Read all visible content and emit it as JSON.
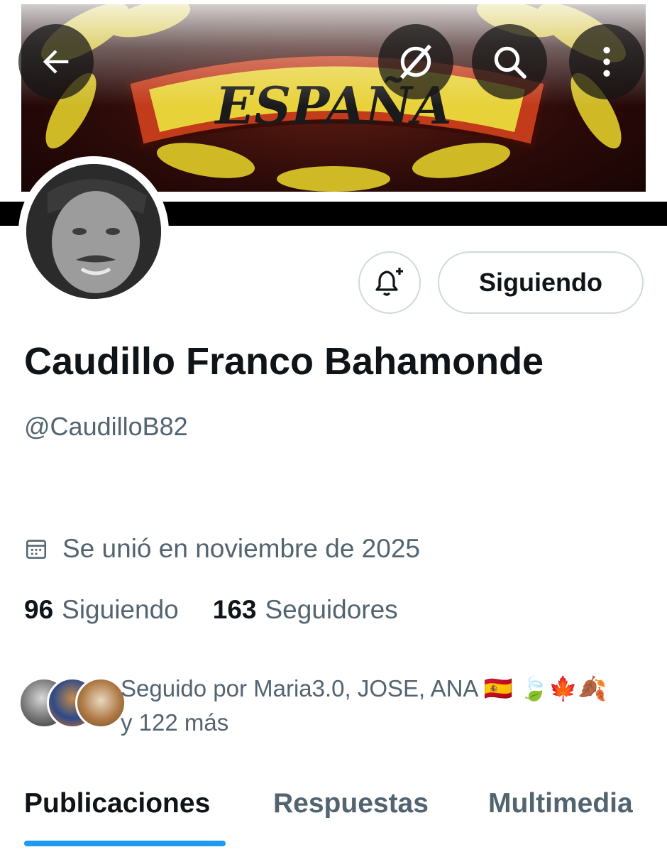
{
  "banner": {
    "text": "ESPAÑA"
  },
  "header": {
    "back_icon": "arrow-left-icon",
    "grok_icon": "grok-icon",
    "search_icon": "search-icon",
    "more_icon": "more-vertical-icon"
  },
  "profile": {
    "display_name": "Caudillo Franco Bahamonde",
    "handle": "@CaudilloB82",
    "joined": "Se unió en noviembre de 2025",
    "following_count": "96",
    "following_label": "Siguiendo",
    "followers_count": "163",
    "followers_label": "Seguidores",
    "followed_by_line1": "Seguido por Maria3.0, JOSE, ANA 🇪🇸 🍃🍁🍂",
    "followed_by_line2": "y 122 más"
  },
  "actions": {
    "notify_icon": "bell-plus-icon",
    "follow_label": "Siguiendo"
  },
  "tabs": [
    {
      "label": "Publicaciones",
      "active": true
    },
    {
      "label": "Respuestas",
      "active": false
    },
    {
      "label": "Multimedia",
      "active": false
    }
  ],
  "colors": {
    "accent": "#1d9bf0",
    "text": "#0f1419",
    "muted": "#536471",
    "border": "#cfd9de"
  }
}
